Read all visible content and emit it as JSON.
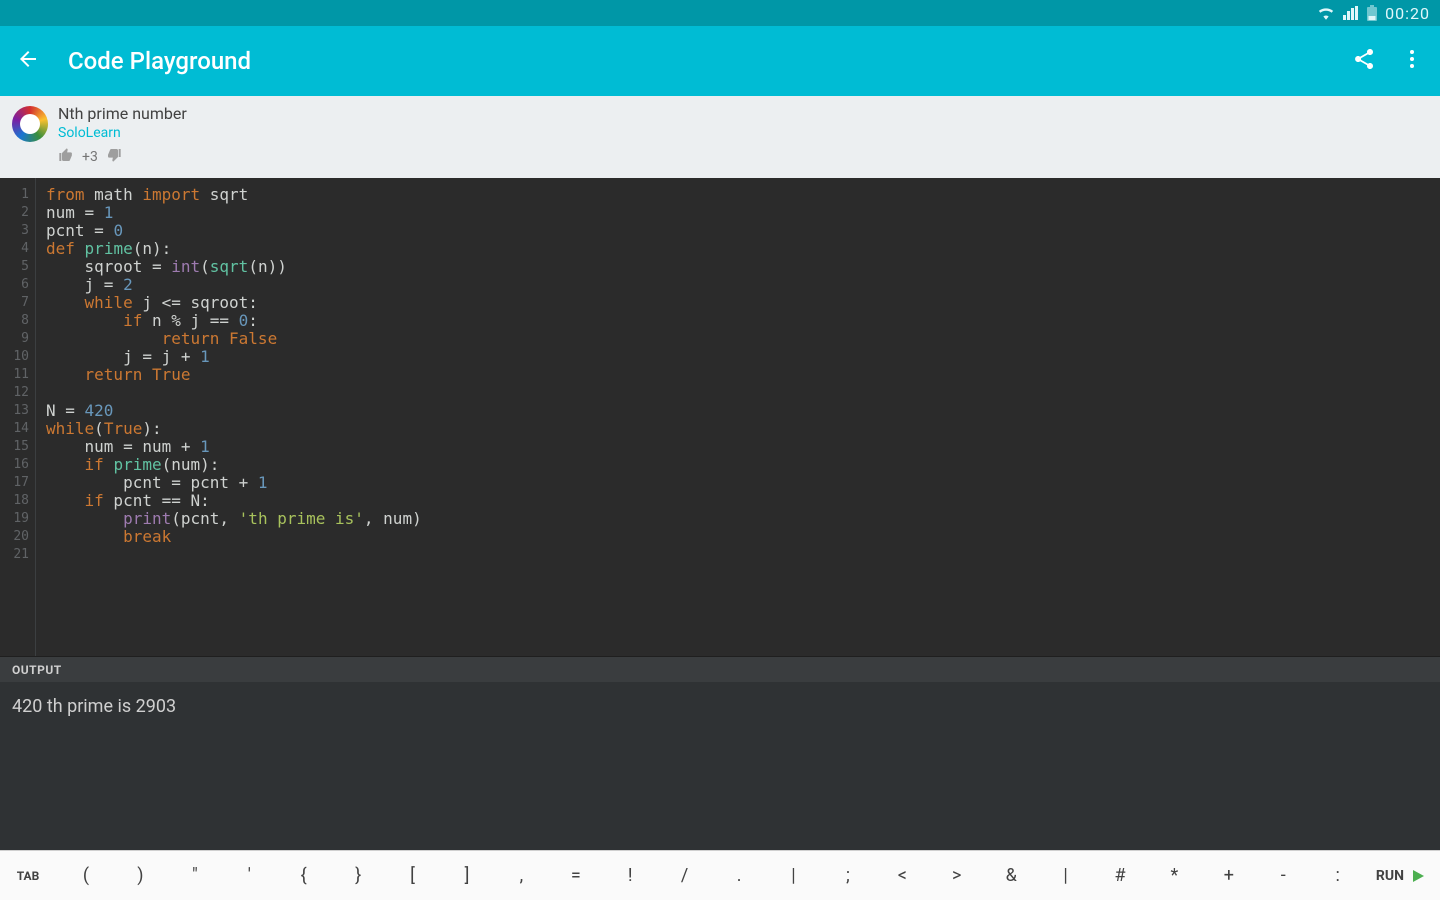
{
  "statusbar": {
    "time": "00:20"
  },
  "appbar": {
    "title": "Code Playground"
  },
  "snippet": {
    "title": "Nth prime number",
    "author": "SoloLearn",
    "score": "+3"
  },
  "code": {
    "lines": 21,
    "tokens": [
      [
        [
          "kw",
          "from"
        ],
        [
          "id",
          " math "
        ],
        [
          "kw",
          "import"
        ],
        [
          "id",
          " sqrt"
        ]
      ],
      [
        [
          "id",
          "num "
        ],
        [
          "id",
          "= "
        ],
        [
          "num",
          "1"
        ]
      ],
      [
        [
          "id",
          "pcnt "
        ],
        [
          "id",
          "= "
        ],
        [
          "num",
          "0"
        ]
      ],
      [
        [
          "kw",
          "def"
        ],
        [
          "id",
          " "
        ],
        [
          "fn",
          "prime"
        ],
        [
          "id",
          "(n):"
        ]
      ],
      [
        [
          "id",
          "    "
        ],
        [
          "id",
          "sqroot = "
        ],
        [
          "bltn",
          "int"
        ],
        [
          "id",
          "("
        ],
        [
          "fn",
          "sqrt"
        ],
        [
          "id",
          "(n))"
        ]
      ],
      [
        [
          "id",
          "    "
        ],
        [
          "id",
          "j = "
        ],
        [
          "num",
          "2"
        ]
      ],
      [
        [
          "id",
          "    "
        ],
        [
          "kw",
          "while"
        ],
        [
          "id",
          " j <= sqroot:"
        ]
      ],
      [
        [
          "id",
          "        "
        ],
        [
          "kw",
          "if"
        ],
        [
          "id",
          " n % j == "
        ],
        [
          "num",
          "0"
        ],
        [
          "id",
          ":"
        ]
      ],
      [
        [
          "id",
          "            "
        ],
        [
          "kw",
          "return"
        ],
        [
          "id",
          " "
        ],
        [
          "kw",
          "False"
        ]
      ],
      [
        [
          "id",
          "        "
        ],
        [
          "id",
          "j = j + "
        ],
        [
          "num",
          "1"
        ]
      ],
      [
        [
          "id",
          "    "
        ],
        [
          "kw",
          "return"
        ],
        [
          "id",
          " "
        ],
        [
          "kw",
          "True"
        ]
      ],
      [],
      [
        [
          "id",
          "N = "
        ],
        [
          "num",
          "420"
        ]
      ],
      [
        [
          "kw",
          "while"
        ],
        [
          "id",
          "("
        ],
        [
          "kw",
          "True"
        ],
        [
          "id",
          "):"
        ]
      ],
      [
        [
          "id",
          "    "
        ],
        [
          "id",
          "num = num + "
        ],
        [
          "num",
          "1"
        ]
      ],
      [
        [
          "id",
          "    "
        ],
        [
          "kw",
          "if"
        ],
        [
          "id",
          " "
        ],
        [
          "fn",
          "prime"
        ],
        [
          "id",
          "(num):"
        ]
      ],
      [
        [
          "id",
          "        "
        ],
        [
          "id",
          "pcnt = pcnt + "
        ],
        [
          "num",
          "1"
        ]
      ],
      [
        [
          "id",
          "    "
        ],
        [
          "kw",
          "if"
        ],
        [
          "id",
          " pcnt == N:"
        ]
      ],
      [
        [
          "id",
          "        "
        ],
        [
          "bltn",
          "print"
        ],
        [
          "id",
          "(pcnt, "
        ],
        [
          "str",
          "'th prime is'"
        ],
        [
          "id",
          ", num)"
        ]
      ],
      [
        [
          "id",
          "        "
        ],
        [
          "kw",
          "break"
        ]
      ],
      []
    ]
  },
  "output": {
    "label": "OUTPUT",
    "text": "420 th prime is 2903"
  },
  "symbar": {
    "tab": "TAB",
    "run": "RUN",
    "keys": [
      "(",
      ")",
      "\"",
      "'",
      "{",
      "}",
      "[",
      "]",
      ",",
      "=",
      "!",
      "/",
      ".",
      "|",
      ";",
      "<",
      ">",
      "&",
      "|",
      "#",
      "*",
      "+",
      "-",
      ":"
    ]
  }
}
